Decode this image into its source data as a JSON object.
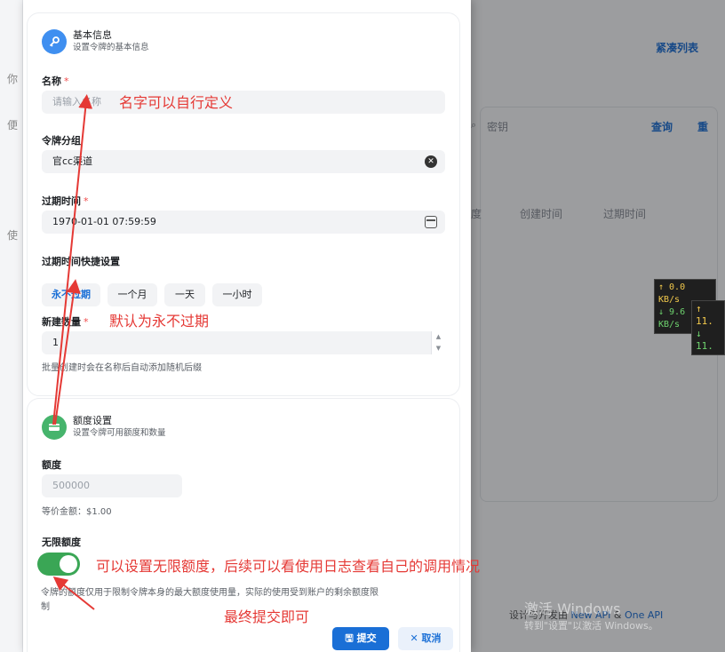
{
  "background": {
    "list_link": "紧凑列表",
    "search_placeholder": "密钥",
    "query_button": "查询",
    "reset_button": "重",
    "col_partial": "度",
    "col_created": "创建时间",
    "col_expire": "过期时间",
    "left_glyphs": [
      "你",
      "便",
      "使"
    ],
    "net_speed_1": {
      "up": "↑ 0.0 KB/s",
      "down": "↓ 9.6 KB/s"
    },
    "net_speed_2": {
      "up": "↑ 11.",
      "down": "↓ 11."
    },
    "footer_prefix": "设计与开发由",
    "footer_link1": "New API",
    "footer_amp": "&",
    "footer_link2": "One API",
    "activate_title": "激活 Windows",
    "activate_sub": "转到\"设置\"以激活 Windows。"
  },
  "basic_section": {
    "title": "基本信息",
    "subtitle": "设置令牌的基本信息",
    "icon": "key-icon"
  },
  "name_field": {
    "label": "名称",
    "required_mark": "*",
    "placeholder": "请输入名称"
  },
  "group_field": {
    "label": "令牌分组",
    "value": "官cc渠道"
  },
  "expire_field": {
    "label": "过期时间",
    "required_mark": "*",
    "value": "1970-01-01 07:59:59"
  },
  "quick_expire": {
    "label": "过期时间快捷设置",
    "options": [
      "永不过期",
      "一个月",
      "一天",
      "一小时"
    ],
    "selected": "永不过期"
  },
  "count_field": {
    "label": "新建数量",
    "required_mark": "*",
    "value": "1",
    "hint": "批量创建时会在名称后自动添加随机后缀"
  },
  "quota_section": {
    "title": "额度设置",
    "subtitle": "设置令牌可用额度和数量",
    "icon": "card-icon"
  },
  "quota_field": {
    "label": "额度",
    "placeholder": "500000",
    "equivalent": "等价金额：$1.00"
  },
  "unlimited": {
    "label": "无限额度",
    "enabled": true,
    "hint_line1": "令牌的额度仅用于限制令牌本身的最大额度使用量，实际的使用受到账户的剩余额度限",
    "hint_line2": "制"
  },
  "actions": {
    "submit": "提交",
    "cancel": "取消"
  },
  "annotations": {
    "name_note": "名字可以自行定义",
    "expire_note": "默认为永不过期",
    "unlimited_note": "可以设置无限额度，后续可以看使用日志查看自己的调用情况",
    "submit_note": "最终提交即可",
    "color": "#e53935"
  }
}
